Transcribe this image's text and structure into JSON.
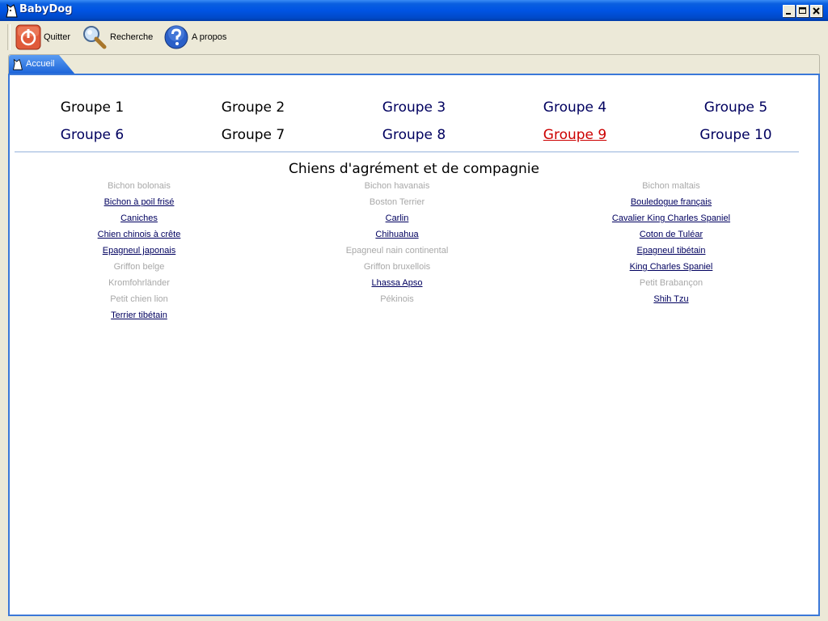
{
  "window": {
    "title": "BabyDog"
  },
  "toolbar": {
    "quit_label": "Quitter",
    "search_label": "Recherche",
    "about_label": "A propos"
  },
  "tabs": [
    {
      "label": "Accueil",
      "icon": "dog-head-icon"
    }
  ],
  "groups": [
    {
      "label": "Groupe 1",
      "state": "normal"
    },
    {
      "label": "Groupe 2",
      "state": "normal"
    },
    {
      "label": "Groupe 3",
      "state": "normal"
    },
    {
      "label": "Groupe 4",
      "state": "normal"
    },
    {
      "label": "Groupe 5",
      "state": "normal"
    },
    {
      "label": "Groupe 6",
      "state": "normal"
    },
    {
      "label": "Groupe 7",
      "state": "normal"
    },
    {
      "label": "Groupe 8",
      "state": "normal"
    },
    {
      "label": "Groupe 9",
      "state": "selected"
    },
    {
      "label": "Groupe 10",
      "state": "normal"
    }
  ],
  "section": {
    "title": "Chiens d'agrément et de compagnie",
    "columns": [
      [
        {
          "name": "Bichon bolonais",
          "enabled": false
        },
        {
          "name": "Bichon à poil frisé",
          "enabled": true
        },
        {
          "name": "Caniches",
          "enabled": true
        },
        {
          "name": "Chien chinois à crête",
          "enabled": true
        },
        {
          "name": "Epagneul japonais",
          "enabled": true
        },
        {
          "name": "Griffon belge",
          "enabled": false
        },
        {
          "name": "Kromfohrländer",
          "enabled": false
        },
        {
          "name": "Petit chien lion",
          "enabled": false
        },
        {
          "name": "Terrier tibétain",
          "enabled": true
        }
      ],
      [
        {
          "name": "Bichon havanais",
          "enabled": false
        },
        {
          "name": "Boston Terrier",
          "enabled": false
        },
        {
          "name": "Carlin",
          "enabled": true
        },
        {
          "name": "Chihuahua",
          "enabled": true
        },
        {
          "name": "Epagneul nain continental",
          "enabled": false
        },
        {
          "name": "Griffon bruxellois",
          "enabled": false
        },
        {
          "name": "Lhassa Apso",
          "enabled": true
        },
        {
          "name": "Pékinois",
          "enabled": false
        }
      ],
      [
        {
          "name": "Bichon maltais",
          "enabled": false
        },
        {
          "name": "Bouledogue français",
          "enabled": true
        },
        {
          "name": "Cavalier King Charles Spaniel",
          "enabled": true
        },
        {
          "name": "Coton de Tuléar",
          "enabled": true
        },
        {
          "name": "Epagneul tibétain",
          "enabled": true
        },
        {
          "name": "King Charles Spaniel",
          "enabled": true
        },
        {
          "name": "Petit Brabançon",
          "enabled": false
        },
        {
          "name": "Shih Tzu",
          "enabled": true
        }
      ]
    ]
  },
  "colors": {
    "titlebar": "#0054e3",
    "link": "#00005f",
    "selected_group": "#cc0000",
    "disabled_text": "#a8a8a8"
  }
}
